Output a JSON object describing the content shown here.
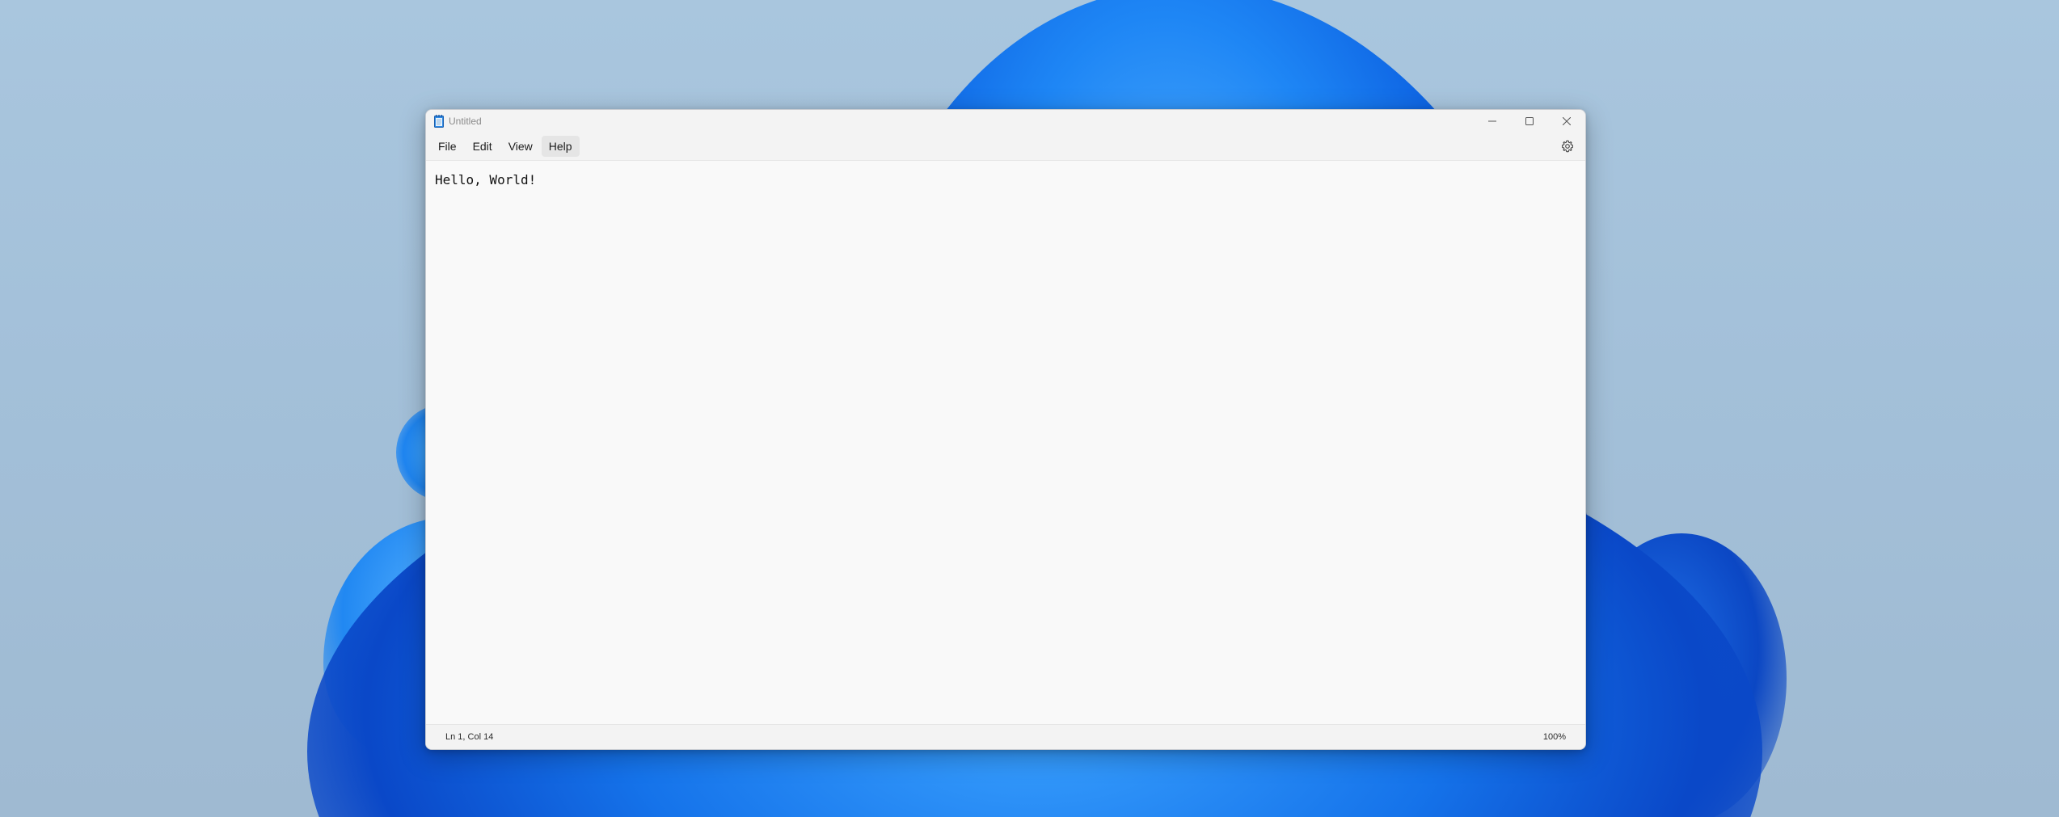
{
  "window": {
    "title": "Untitled",
    "caption": {
      "minimize_icon": "minimize-icon",
      "maximize_icon": "maximize-icon",
      "close_icon": "close-icon"
    }
  },
  "menubar": {
    "items": [
      {
        "label": "File"
      },
      {
        "label": "Edit"
      },
      {
        "label": "View"
      },
      {
        "label": "Help"
      }
    ],
    "settings_icon": "gear-icon"
  },
  "editor": {
    "content": "Hello, World!"
  },
  "statusbar": {
    "position": "Ln 1, Col 14",
    "zoom": "100%"
  },
  "colors": {
    "accent": "#1e86f5",
    "window_bg": "#f9f9f9",
    "chrome_bg": "#f3f3f3"
  }
}
